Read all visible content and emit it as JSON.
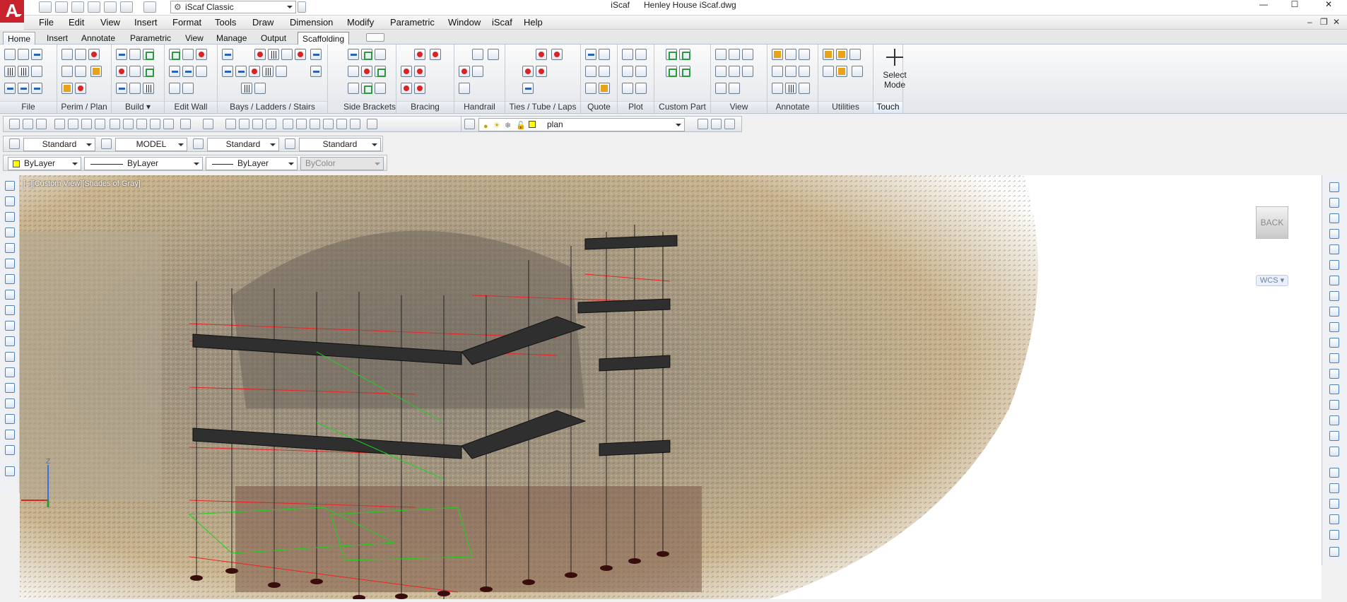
{
  "title_bar": {
    "app_name": "iScaf",
    "document_title": "Henley House iScaf.dwg",
    "workspace": "iScaf Classic",
    "min_label": "—",
    "max_label": "☐",
    "close_label": "✕"
  },
  "menubar": {
    "items": [
      "File",
      "Edit",
      "View",
      "Insert",
      "Format",
      "Tools",
      "Draw",
      "Dimension",
      "Modify",
      "Parametric",
      "Window",
      "iScaf",
      "Help"
    ],
    "mdi": [
      "–",
      "❐",
      "✕"
    ]
  },
  "ribbon": {
    "tabs": [
      "Home",
      "Insert",
      "Annotate",
      "Parametric",
      "View",
      "Manage",
      "Output",
      "Scaffolding"
    ],
    "active_tab": "Scaffolding",
    "panels": [
      "File",
      "Perim / Plan",
      "Build",
      "Edit Wall",
      "Bays /  Ladders / Stairs",
      "Side Brackets",
      "Bracing",
      "Handrail",
      "Ties / Tube / Laps",
      "Quote",
      "Plot",
      "Custom Part",
      "View",
      "Annotate",
      "Utilities",
      "Touch"
    ],
    "build_dropdown": "▾",
    "select_mode": "Select Mode"
  },
  "layers_toolbar": {
    "layer": "plan"
  },
  "styles_toolbar": {
    "text_style": "Standard",
    "space": "MODEL",
    "dim_style": "Standard",
    "table_style": "Standard"
  },
  "properties_toolbar": {
    "color": "ByLayer",
    "linetype": "ByLayer",
    "lineweight": "ByLayer",
    "plot_style": "ByColor"
  },
  "viewport": {
    "view_label": "[−][Custom View][Shades of Gray]",
    "viewcube_face": "BACK",
    "wcs": "WCS ▾"
  }
}
